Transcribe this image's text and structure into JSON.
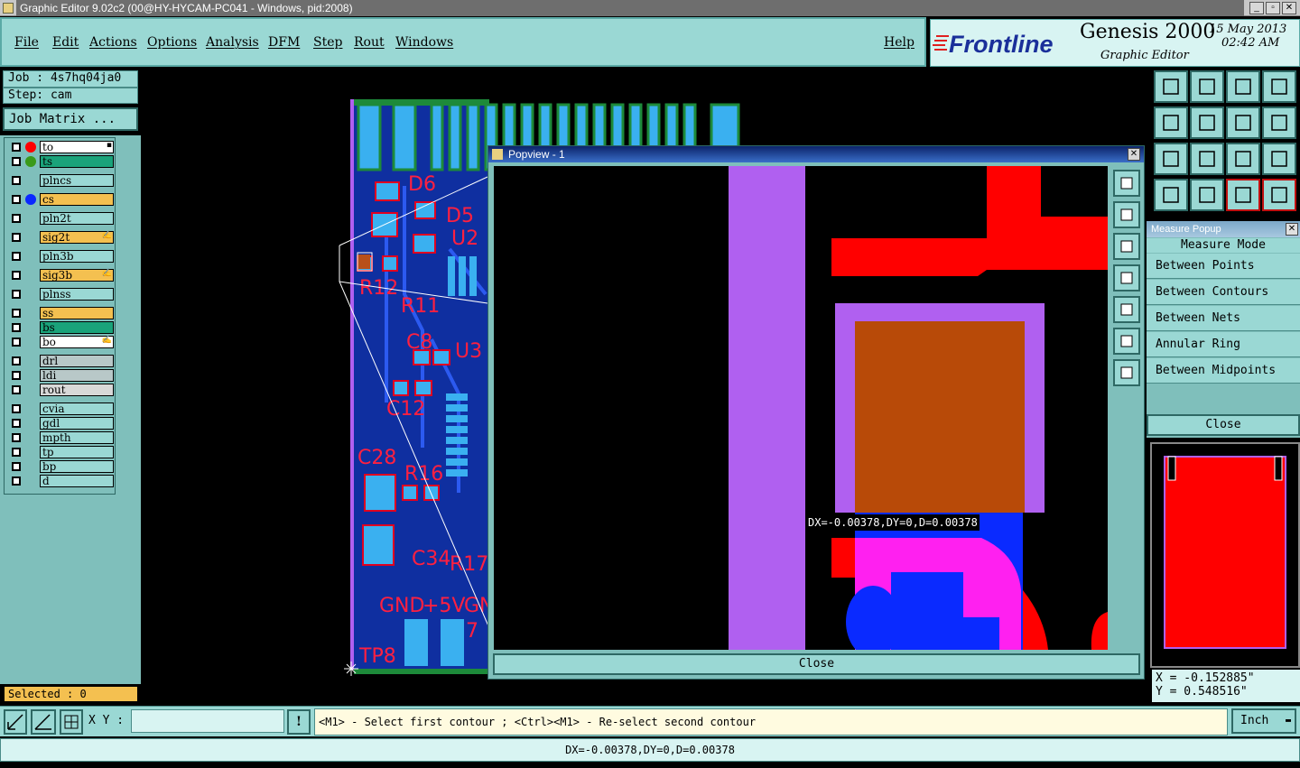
{
  "window": {
    "title": "Graphic Editor 9.02c2 (00@HY-HYCAM-PC041 - Windows, pid:2008)"
  },
  "menu": [
    "File",
    "Edit",
    "Actions",
    "Options",
    "Analysis",
    "DFM",
    "Step",
    "Rout",
    "Windows"
  ],
  "help": "Help",
  "brand": {
    "logo": "Frontline",
    "product": "Genesis 2000",
    "subtitle": "Graphic Editor",
    "date": "15 May 2013",
    "time": "02:42 AM"
  },
  "job": {
    "job_line": "Job : 4s7hq04ja0",
    "step_line": "Step: cam",
    "matrix_button": "Job Matrix ..."
  },
  "layers": [
    {
      "name": "to",
      "color": "#ffffff",
      "dot": "#ff0000",
      "mark": "▪"
    },
    {
      "name": "ts",
      "color": "#1aa37a",
      "dot": "#3a9a1a",
      "mark": ""
    },
    {
      "name": "plncs",
      "color": "#9ad8d4",
      "dot": "",
      "mark": ""
    },
    {
      "name": "cs",
      "color": "#f4c050",
      "dot": "#0a28ff",
      "mark": ""
    },
    {
      "name": "pln2t",
      "color": "#9ad8d4",
      "dot": "",
      "mark": ""
    },
    {
      "name": "sig2t",
      "color": "#f4c050",
      "dot": "",
      "mark": "✍"
    },
    {
      "name": "pln3b",
      "color": "#9ad8d4",
      "dot": "",
      "mark": ""
    },
    {
      "name": "sig3b",
      "color": "#f4c050",
      "dot": "",
      "mark": "✍"
    },
    {
      "name": "plnss",
      "color": "#9ad8d4",
      "dot": "",
      "mark": ""
    },
    {
      "name": "ss",
      "color": "#f4c050",
      "dot": "",
      "mark": ""
    },
    {
      "name": "bs",
      "color": "#1aa37a",
      "dot": "",
      "mark": ""
    },
    {
      "name": "bo",
      "color": "#ffffff",
      "dot": "",
      "mark": "✍"
    },
    {
      "name": "drl",
      "color": "#b8c8c8",
      "dot": "",
      "mark": ""
    },
    {
      "name": "ldi",
      "color": "#b8c8c8",
      "dot": "",
      "mark": ""
    },
    {
      "name": "rout",
      "color": "#d8d8d8",
      "dot": "",
      "mark": ""
    },
    {
      "name": "cvia",
      "color": "#9ad8d4",
      "dot": "",
      "mark": ""
    },
    {
      "name": "gdl",
      "color": "#9ad8d4",
      "dot": "",
      "mark": ""
    },
    {
      "name": "mpth",
      "color": "#9ad8d4",
      "dot": "",
      "mark": ""
    },
    {
      "name": "tp",
      "color": "#9ad8d4",
      "dot": "",
      "mark": ""
    },
    {
      "name": "bp",
      "color": "#9ad8d4",
      "dot": "",
      "mark": ""
    },
    {
      "name": "d",
      "color": "#9ad8d4",
      "dot": "",
      "mark": ""
    }
  ],
  "selected": "Selected : 0",
  "popview": {
    "title": "Popview - 1",
    "close": "Close",
    "measure_label": "DX=-0.00378,DY=0,D=0.00378"
  },
  "board_labels": [
    "D6",
    "D5",
    "U2",
    "R12",
    "R11",
    "C8",
    "U3",
    "C12",
    "C28",
    "R16",
    "C34",
    "R17",
    "GND",
    "+5V",
    "GN",
    "7",
    "TP8"
  ],
  "measure": {
    "title": "Measure Popup",
    "mode": "Measure Mode",
    "items": [
      "Between Points",
      "Between Contours",
      "Between Nets",
      "Annular Ring",
      "Between Midpoints"
    ],
    "close": "Close"
  },
  "coords": {
    "x": "X = -0.152885\"",
    "y": "Y = 0.548516\""
  },
  "cmd": {
    "xy_label": "X Y :",
    "xy_value": "",
    "prompt": "<M1> - Select first contour ; <Ctrl><M1> - Re-select second contour",
    "units": "Inch"
  },
  "status": "DX=-0.00378,DY=0,D=0.00378",
  "window_buttons": [
    "_",
    "▫",
    "✕"
  ]
}
